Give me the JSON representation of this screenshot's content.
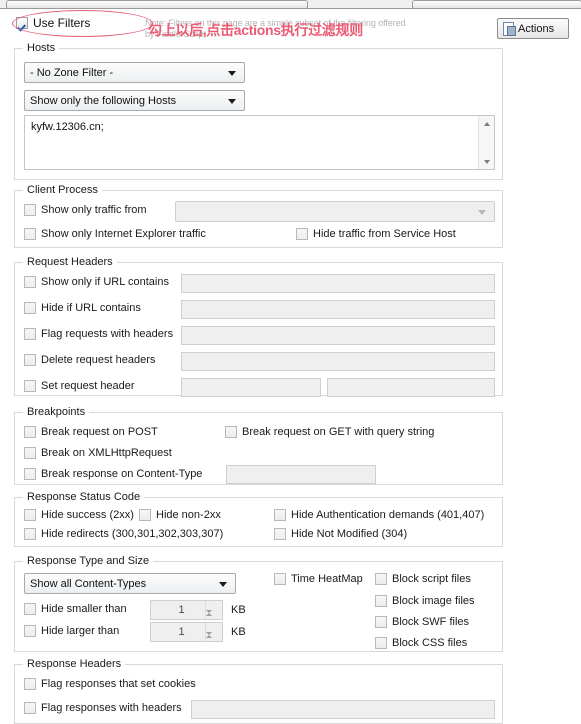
{
  "window": {
    "tabstrip_present": true
  },
  "header": {
    "use_filters_label": "Use Filters",
    "use_filters_checked": true,
    "note_text": "Note: Filters on this page are a simple subset of the filtering offered by FiddlerScript.",
    "actions_label": "Actions",
    "annotation_text": "勾上以后,点击actions执行过滤规则",
    "annotation_color": "#ec5b74"
  },
  "hosts": {
    "title": "Hosts",
    "zone_filter_value": "- No Zone Filter -",
    "host_filter_value": "Show only the following Hosts",
    "hosts_text": "kyfw.12306.cn;"
  },
  "client_process": {
    "title": "Client Process",
    "show_only_traffic_from_label": "Show only traffic from",
    "show_only_traffic_from_checked": false,
    "process_combo_value": "",
    "show_only_ie_label": "Show only Internet Explorer traffic",
    "show_only_ie_checked": false,
    "hide_service_host_label": "Hide traffic from Service Host",
    "hide_service_host_checked": false
  },
  "request_headers": {
    "title": "Request Headers",
    "rows": [
      {
        "label": "Show only if URL contains",
        "checked": false,
        "value": ""
      },
      {
        "label": "Hide if URL contains",
        "checked": false,
        "value": ""
      },
      {
        "label": "Flag requests with headers",
        "checked": false,
        "value": ""
      },
      {
        "label": "Delete request headers",
        "checked": false,
        "value": ""
      },
      {
        "label": "Set request header",
        "checked": false,
        "value": "",
        "value2": ""
      }
    ]
  },
  "breakpoints": {
    "title": "Breakpoints",
    "break_on_post_label": "Break request on POST",
    "break_on_post_checked": false,
    "break_on_get_label": "Break request on GET with query string",
    "break_on_get_checked": false,
    "break_on_xhr_label": "Break on XMLHttpRequest",
    "break_on_xhr_checked": false,
    "break_response_ct_label": "Break response on Content-Type",
    "break_response_ct_checked": false,
    "break_response_ct_value": ""
  },
  "response_status": {
    "title": "Response Status Code",
    "hide_success_label": "Hide success (2xx)",
    "hide_success_checked": false,
    "hide_non2xx_label": "Hide non-2xx",
    "hide_non2xx_checked": false,
    "hide_auth_label": "Hide Authentication demands (401,407)",
    "hide_auth_checked": false,
    "hide_redirects_label": "Hide redirects (300,301,302,303,307)",
    "hide_redirects_checked": false,
    "hide_notmodified_label": "Hide Not Modified (304)",
    "hide_notmodified_checked": false
  },
  "response_type": {
    "title": "Response Type and Size",
    "content_type_value": "Show all Content-Types",
    "hide_smaller_label": "Hide smaller than",
    "hide_smaller_checked": false,
    "hide_smaller_value": "1",
    "hide_smaller_unit": "KB",
    "hide_larger_label": "Hide larger than",
    "hide_larger_checked": false,
    "hide_larger_value": "1",
    "hide_larger_unit": "KB",
    "time_heatmap_label": "Time HeatMap",
    "time_heatmap_checked": false,
    "block_script_label": "Block script files",
    "block_script_checked": false,
    "block_image_label": "Block image files",
    "block_image_checked": false,
    "block_swf_label": "Block SWF files",
    "block_swf_checked": false,
    "block_css_label": "Block CSS files",
    "block_css_checked": false
  },
  "response_headers": {
    "title": "Response Headers",
    "flag_cookies_label": "Flag responses that set cookies",
    "flag_cookies_checked": false,
    "flag_headers_label": "Flag responses with headers",
    "flag_headers_checked": false,
    "flag_headers_value": ""
  }
}
